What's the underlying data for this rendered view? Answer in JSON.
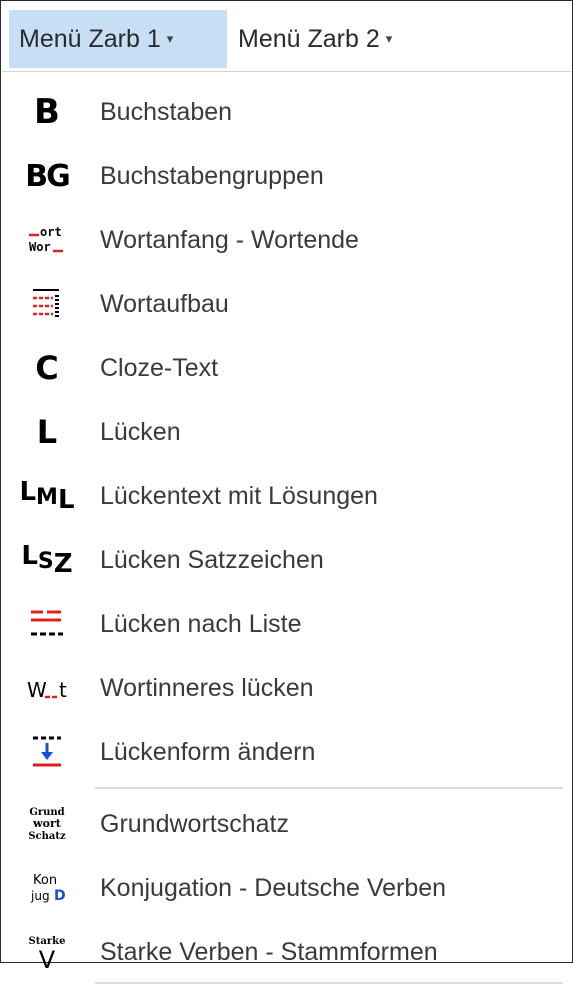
{
  "menubar": {
    "tabs": [
      {
        "label": "Menü Zarb 1",
        "caret": "▾"
      },
      {
        "label": "Menü Zarb 2",
        "caret": "▾"
      }
    ]
  },
  "menu_items": [
    {
      "label": "Buchstaben",
      "icon": "letter-b-icon"
    },
    {
      "label": "Buchstabengruppen",
      "icon": "letter-group-icon"
    },
    {
      "label": "Wortanfang - Wortende",
      "icon": "word-start-end-icon"
    },
    {
      "label": "Wortaufbau",
      "icon": "word-structure-icon"
    },
    {
      "label": "Cloze-Text",
      "icon": "letter-c-icon"
    },
    {
      "label": "Lücken",
      "icon": "letter-l-icon"
    },
    {
      "label": "Lückentext mit Lösungen",
      "icon": "gap-text-solutions-icon"
    },
    {
      "label": "Lücken Satzzeichen",
      "icon": "gap-punctuation-icon"
    },
    {
      "label": "Lücken nach Liste",
      "icon": "gap-list-icon"
    },
    {
      "label": "Wortinneres lücken",
      "icon": "word-inner-gap-icon"
    },
    {
      "label": "Lückenform ändern",
      "icon": "gap-form-change-icon"
    },
    {
      "label": "Grundwortschatz",
      "icon": "basic-vocabulary-icon"
    },
    {
      "label": "Konjugation - Deutsche Verben",
      "icon": "conjugation-icon"
    },
    {
      "label": "Starke Verben - Stammformen",
      "icon": "strong-verbs-icon"
    }
  ],
  "icon_text": {
    "b": "B",
    "bg": "BG",
    "c": "C",
    "l": "L",
    "lml_1": "L",
    "lml_2": "M",
    "lml_3": "L",
    "lsz_1": "L",
    "lsz_2": "S",
    "lsz_3": "Z",
    "w_t_1": "W",
    "w_t_2": "t",
    "wort_top": "ort",
    "wort_bottom": "Wor",
    "grund_1": "Grund",
    "grund_2": "wort",
    "grund_3": "Schatz",
    "konj_1": "Kon",
    "konj_2": "jug",
    "konj_3": "D",
    "starke_1": "Starke",
    "starke_2": "V"
  },
  "colors": {
    "active_tab_bg": "#c7dff5",
    "accent_red": "#e02020",
    "accent_blue": "#1a4fd8",
    "label_text": "#3a3a3a"
  }
}
